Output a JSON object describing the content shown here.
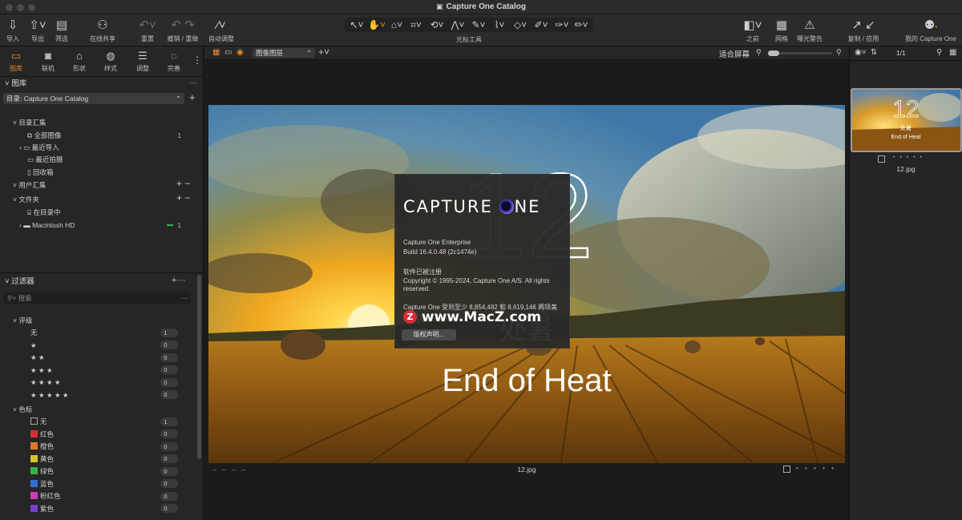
{
  "window": {
    "title": "Capture One Catalog"
  },
  "toolbar": {
    "import": "导入",
    "export": "导出",
    "filter": "筛选",
    "share": "在线共享",
    "reset": "重置",
    "undo_redo": "撤销 / 重做",
    "auto_adjust": "自动调整",
    "cursor_tools": "光标工具",
    "before": "之前",
    "grid": "网格",
    "exposure_warning": "曝光警告",
    "copy_apply": "复制 / 应用",
    "my_account": "我的 Capture One"
  },
  "tool_tabs": [
    "图库",
    "联机",
    "形状",
    "样式",
    "调整",
    "完善"
  ],
  "library": {
    "title": "图库",
    "catalog_label": "目录: Capture One Catalog",
    "catalog_collections": "目录汇集",
    "items": [
      {
        "label": "全部图像",
        "count": "1"
      },
      {
        "label": "最近导入",
        "count": ""
      },
      {
        "label": "最近拍摄",
        "count": ""
      },
      {
        "label": "回收箱",
        "count": ""
      }
    ],
    "user_collections": "用户汇集",
    "folders": "文件夹",
    "in_catalog": "在目录中",
    "drive": "Macintosh HD",
    "drive_count": "1"
  },
  "filters": {
    "title": "过滤器",
    "search_placeholder": "搜索",
    "rating_title": "评级",
    "ratings": [
      {
        "label": "无",
        "count": "1"
      },
      {
        "label": "★",
        "count": "0"
      },
      {
        "label": "★ ★",
        "count": "0"
      },
      {
        "label": "★ ★ ★",
        "count": "0"
      },
      {
        "label": "★ ★ ★ ★",
        "count": "0"
      },
      {
        "label": "★ ★ ★ ★ ★",
        "count": "0"
      }
    ],
    "color_title": "色标",
    "colors": [
      {
        "label": "无",
        "count": "1",
        "color": "none"
      },
      {
        "label": "红色",
        "count": "0",
        "color": "#d0312d"
      },
      {
        "label": "橙色",
        "count": "0",
        "color": "#e0782a"
      },
      {
        "label": "黄色",
        "count": "0",
        "color": "#d6c328"
      },
      {
        "label": "绿色",
        "count": "0",
        "color": "#3bb14a"
      },
      {
        "label": "蓝色",
        "count": "0",
        "color": "#2f6fd1"
      },
      {
        "label": "粉红色",
        "count": "0",
        "color": "#cf3ab9"
      },
      {
        "label": "紫色",
        "count": "0",
        "color": "#7a3fd0"
      }
    ]
  },
  "viewer": {
    "layer_select": "图像图层",
    "fit_label": "适合屏幕",
    "filename": "12.jpg",
    "placeholders": "--   --   --   --",
    "photo_number": "12",
    "photo_cn": "处暑",
    "photo_en": "End of Heat"
  },
  "about": {
    "logo_left": "CAPTURE",
    "logo_right": "NE",
    "product": "Capture One Enterprise",
    "build": "Build 16.4.0.48 (2c1474e)",
    "registered": "软件已被注册",
    "copyright": "Copyright © 1995-2024, Capture One A/S. All rights reserved.",
    "patent": "Capture One 受到至少 8,854,482 和 8,619,146 两项美",
    "watermark": "www.MacZ.com",
    "button": "版权声明..."
  },
  "browser": {
    "count": "1/1",
    "filename": "12.jpg",
    "thumb_cn": "处暑",
    "thumb_en": "End of Heat",
    "thumb_num": "12"
  },
  "colors": {
    "accent": "#e38b2c"
  }
}
